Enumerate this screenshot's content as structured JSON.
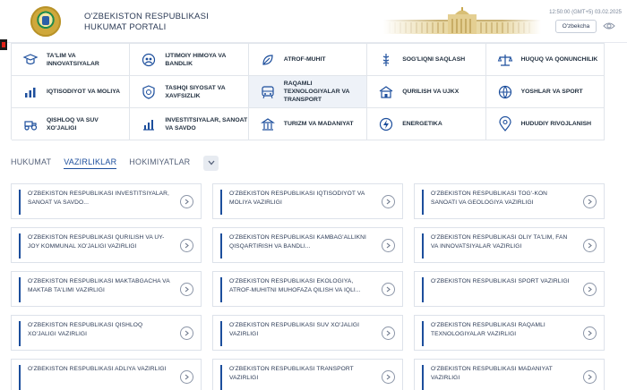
{
  "header": {
    "title_line1": "O'ZBEKISTON RESPUBLIKASI",
    "title_line2": "HUKUMAT PORTALI",
    "datetime": "12:50:00 (GMT+5) 03.02.2025",
    "language_button": "O'zbekcha"
  },
  "categories": [
    {
      "label": "TA'LIM VA INNOVATSIYALAR",
      "icon": "education-icon"
    },
    {
      "label": "IJTIMOIY HIMOYA VA BANDLIK",
      "icon": "social-protection-icon"
    },
    {
      "label": "ATROF-MUHIT",
      "icon": "environment-icon"
    },
    {
      "label": "SOG'LIQNI SAQLASH",
      "icon": "health-icon"
    },
    {
      "label": "HUQUQ VA QONUNCHILIK",
      "icon": "law-icon"
    },
    {
      "label": "IQTISODIYOT VA MOLIYA",
      "icon": "economy-icon"
    },
    {
      "label": "TASHQI SIYOSAT VA XAVFSIZLIK",
      "icon": "foreign-policy-icon"
    },
    {
      "label": "RAQAMLI TEXNOLOGIYALAR VA TRANSPORT",
      "icon": "digital-transport-icon"
    },
    {
      "label": "QURILISH VA UJKX",
      "icon": "construction-icon"
    },
    {
      "label": "YOSHLAR VA SPORT",
      "icon": "youth-sport-icon"
    },
    {
      "label": "QISHLOQ VA SUV XO'JALIGI",
      "icon": "agriculture-icon"
    },
    {
      "label": "INVESTITSIYALAR, SANOAT VA SAVDO",
      "icon": "investment-icon"
    },
    {
      "label": "TURIZM VA MADANIYAT",
      "icon": "tourism-icon"
    },
    {
      "label": "ENERGETIKA",
      "icon": "energy-icon"
    },
    {
      "label": "HUDUDIY RIVOJLANISH",
      "icon": "regional-icon"
    }
  ],
  "tabs": {
    "hukumat": "HUKUMAT",
    "vazirliklar": "VAZIRLIKLAR",
    "hokimiyatlar": "HOKIMIYATLAR"
  },
  "ministries": [
    "O'ZBEKISTON RESPUBLIKASI INVESTITSIYALAR, SANOAT VA SAVDO...",
    "O'ZBEKISTON RESPUBLIKASI IQTISODIYOT VA MOLIYA VAZIRLIGI",
    "O'ZBEKISTON RESPUBLIKASI TOG'-KON SANOATI VA GEOLOGIYA VAZIRLIGI",
    "O'ZBEKISTON RESPUBLIKASI QURILISH VA UY-JOY KOMMUNAL XO'JALIGI VAZIRLIGI",
    "O'ZBEKISTON RESPUBLIKASI KAMBAG'ALLIKNI QISQARTIRISH VA BANDLI...",
    "O'ZBEKISTON RESPUBLIKASI OLIY TA'LIM, FAN VA INNOVATSIYALAR VAZIRLIGI",
    "O'ZBEKISTON RESPUBLIKASI MAKTABGACHA VA MAKTAB TA'LIMI VAZIRLIGI",
    "O'ZBEKISTON RESPUBLIKASI EKOLOGIYA, ATROF-MUHITNI MUHOFAZA QILISH VA IQLI...",
    "O'ZBEKISTON RESPUBLIKASI SPORT VAZIRLIGI",
    "O'ZBEKISTON RESPUBLIKASI QISHLOQ XO'JALIGI VAZIRLIGI",
    "O'ZBEKISTON RESPUBLIKASI SUV XO'JALIGI VAZIRLIGI",
    "O'ZBEKISTON RESPUBLIKASI RAQAMLI TEXNOLOGIYALAR VAZIRLIGI",
    "O'ZBEKISTON RESPUBLIKASI ADLIYA VAZIRLIGI",
    "O'ZBEKISTON RESPUBLIKASI TRANSPORT VAZIRLIGI",
    "O'ZBEKISTON RESPUBLIKASI MADANIYAT VAZIRLIGI"
  ],
  "colors": {
    "accent": "#1c4e9c",
    "active_cell": "#eef2f8",
    "border": "#e1e5eb",
    "text": "#1f2d3d"
  }
}
